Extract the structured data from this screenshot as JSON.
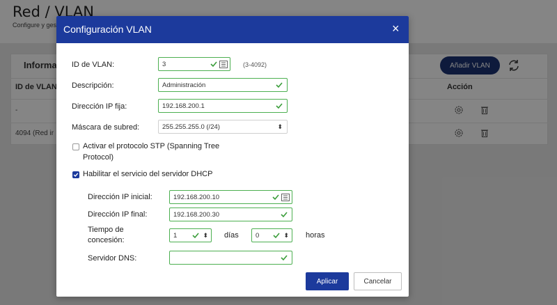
{
  "page": {
    "title": "Red / VLAN",
    "subtitle": "Configure y gest",
    "panel_title": "Informa",
    "add_button": "Añadir VLAN",
    "columns": {
      "id": "ID de VLAN",
      "action": "Acción"
    },
    "rows": [
      {
        "id": "-"
      },
      {
        "id": "4094 (Red ir"
      }
    ]
  },
  "modal": {
    "title": "Configuración VLAN",
    "close": "×",
    "vlan_id": {
      "label": "ID de VLAN:",
      "value": "3",
      "hint": "(3-4092)"
    },
    "description": {
      "label": "Descripción:",
      "value": "Administración"
    },
    "fixed_ip": {
      "label": "Dirección IP fija:",
      "value": "192.168.200.1"
    },
    "subnet_mask": {
      "label": "Máscara de subred:",
      "value": "255.255.255.0 (/24)"
    },
    "stp": {
      "label_line1": "Activar el protocolo STP (Spanning Tree",
      "label_line2": "Protocol)",
      "checked": false
    },
    "dhcp": {
      "label": "Habilitar el servicio del servidor DHCP",
      "checked": true
    },
    "dhcp_start": {
      "label": "Dirección IP inicial:",
      "value": "192.168.200.10"
    },
    "dhcp_end": {
      "label": "Dirección IP final:",
      "value": "192.168.200.30"
    },
    "lease": {
      "label_line1": "Tiempo de",
      "label_line2": "concesión:",
      "days_value": "1",
      "days_unit": "días",
      "hours_value": "0",
      "hours_unit": "horas"
    },
    "dns": {
      "label": "Servidor DNS:",
      "value": ""
    },
    "apply": "Aplicar",
    "cancel": "Cancelar"
  },
  "icons": {
    "valid": "checkmark-icon",
    "keyboard": "keyboard-icon",
    "spinner": "updown-arrows-icon",
    "settings": "gear-icon",
    "delete": "trash-icon",
    "refresh": "refresh-icon"
  },
  "colors": {
    "brand": "#1c3a9c",
    "brand_dark": "#1c3273",
    "valid": "#4caf50"
  }
}
